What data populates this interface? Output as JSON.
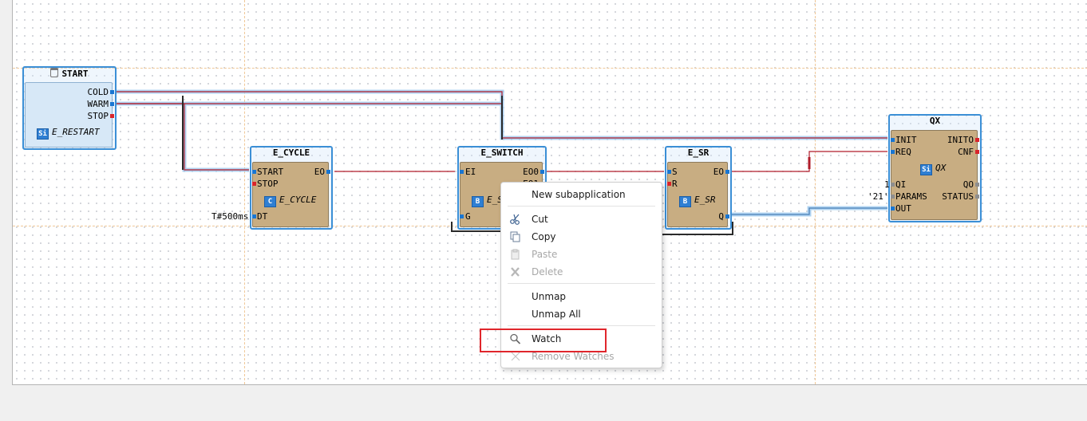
{
  "blocks": {
    "start": {
      "title": "START",
      "ports_out": [
        "COLD",
        "WARM",
        "STOP"
      ],
      "type": "E_RESTART",
      "badge": "Si"
    },
    "e_cycle": {
      "title": "E_CYCLE",
      "ports_in": [
        "START",
        "STOP",
        "DT"
      ],
      "ports_out": [
        "EO"
      ],
      "type": "E_CYCLE",
      "badge": "C",
      "dt_value": "T#500ms"
    },
    "e_switch": {
      "title": "E_SWITCH",
      "ports_in": [
        "EI",
        "G"
      ],
      "ports_out": [
        "EO0",
        "EO1"
      ],
      "type": "E_S",
      "badge": "B"
    },
    "e_sr": {
      "title": "E_SR",
      "ports_in": [
        "S",
        "R"
      ],
      "ports_out": [
        "EO",
        "Q"
      ],
      "type": "E_SR",
      "badge": "B"
    },
    "qx": {
      "title": "QX",
      "ports_in": [
        "INIT",
        "REQ",
        "QI",
        "PARAMS",
        "OUT"
      ],
      "ports_out": [
        "INITO",
        "CNF",
        "QO",
        "STATUS"
      ],
      "type": "QX",
      "badge": "Si",
      "qi_value": "1",
      "params_value": "'21'"
    }
  },
  "context_menu": {
    "items": [
      {
        "label": "New subapplication",
        "enabled": true,
        "icon": ""
      },
      {
        "label": "Cut",
        "enabled": true,
        "icon": "scissors-icon"
      },
      {
        "label": "Copy",
        "enabled": true,
        "icon": "copy-icon"
      },
      {
        "label": "Paste",
        "enabled": false,
        "icon": "paste-icon"
      },
      {
        "label": "Delete",
        "enabled": false,
        "icon": "delete-icon"
      },
      {
        "label": "Unmap",
        "enabled": true,
        "icon": ""
      },
      {
        "label": "Unmap All",
        "enabled": true,
        "icon": ""
      },
      {
        "label": "Watch",
        "enabled": true,
        "icon": "magnifier-icon"
      },
      {
        "label": "Remove Watches",
        "enabled": false,
        "icon": "remove-watch-icon"
      }
    ],
    "highlighted": "Watch"
  },
  "colors": {
    "event_wire": "#b01c2a",
    "selection": "#3b8fd6",
    "fb_body": "#c8ad82",
    "highlight": "#e0262c"
  }
}
